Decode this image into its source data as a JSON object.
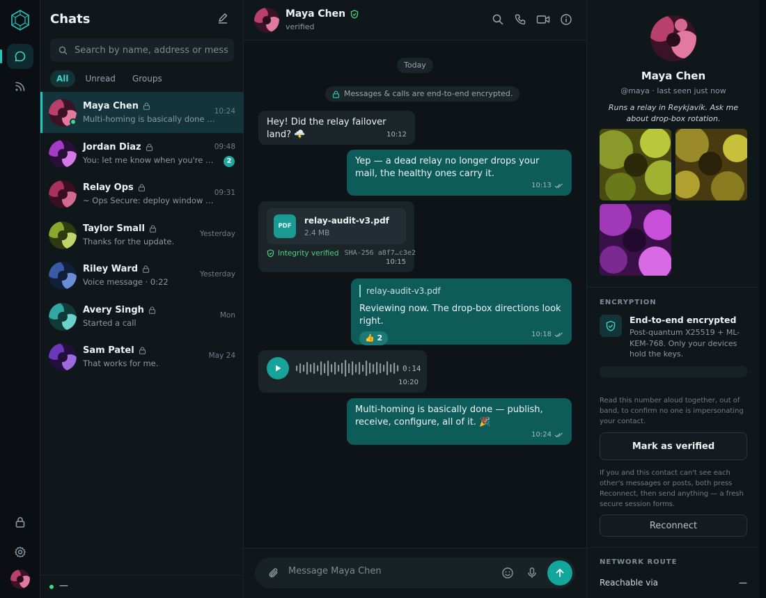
{
  "rail": {
    "items": [
      "chats",
      "feeds"
    ]
  },
  "list": {
    "title": "Chats",
    "search_placeholder": "Search by name, address or message",
    "filters": [
      "All",
      "Unread",
      "Groups"
    ],
    "chats": [
      {
        "name": "Maya Chen",
        "preview": "Multi-homing is basically done 🎉",
        "time": "10:24",
        "online": true,
        "colors": [
          "#3a1426",
          "#b8406a",
          "#e27aa0"
        ]
      },
      {
        "name": "Jordan Diaz",
        "preview": "You: let me know when you're free",
        "time": "09:48",
        "badge": "2",
        "colors": [
          "#2a0f3a",
          "#a53cc8",
          "#d37ae6"
        ]
      },
      {
        "name": "Relay Ops",
        "preview": "~ Ops Secure: deploy window co...",
        "time": "09:31",
        "colors": [
          "#3a1020",
          "#a8325a",
          "#d46a8e"
        ]
      },
      {
        "name": "Taylor Small",
        "preview": "Thanks for the update.",
        "time": "Yesterday",
        "colors": [
          "#2e3a10",
          "#8aa82e",
          "#c0d46a"
        ]
      },
      {
        "name": "Riley Ward",
        "preview": "Voice message · 0:22",
        "time": "Yesterday",
        "colors": [
          "#10203a",
          "#3a5aa8",
          "#6a8ed4"
        ]
      },
      {
        "name": "Avery Singh",
        "preview": "Started a call",
        "time": "Mon",
        "colors": [
          "#0f3a38",
          "#2ea8a0",
          "#6ad4cc"
        ]
      },
      {
        "name": "Sam Patel",
        "preview": "That works for me.",
        "time": "May 24",
        "colors": [
          "#22103a",
          "#6a38b8",
          "#9e6ae0"
        ]
      }
    ],
    "status_text": "—"
  },
  "conversation": {
    "name": "Maya Chen",
    "subtitle": "verified",
    "date_pill": "Today",
    "e2e_notice": "Messages & calls are end-to-end encrypted.",
    "messages": {
      "m1": {
        "text": "Hey! Did the relay failover land? 🌩️",
        "time": "10:12"
      },
      "m2": {
        "text": "Yep — a dead relay no longer drops your mail, the healthy ones carry it.",
        "time": "10:13"
      },
      "m3": {
        "file_name": "relay-audit-v3.pdf",
        "file_size": "2.4 MB",
        "file_type": "PDF",
        "integrity": "Integrity verified",
        "hash": "SHA-256 a8f7…c3e2",
        "time": "10:15"
      },
      "m4": {
        "reply_to": "relay-audit-v3.pdf",
        "text": "Reviewing now. The drop-box directions look right.",
        "reaction": "👍 2",
        "time": "10:18"
      },
      "m5": {
        "duration": "0:14",
        "time": "10:20"
      },
      "m6": {
        "text": "Multi-homing is basically done — publish, receive, configure, all of it. 🎉",
        "time": "10:24"
      }
    },
    "composer_placeholder": "Message Maya Chen"
  },
  "details": {
    "name": "Maya Chen",
    "subtitle": "@maya · last seen just now",
    "bio": "Runs a relay in Reykjavík. Ask me about drop-box rotation.",
    "encryption_section": "ENCRYPTION",
    "encryption_title": "End-to-end encrypted",
    "encryption_desc": "Post-quantum X25519 + ML-KEM-768. Only your devices hold the keys.",
    "safety_note": "Read this number aloud together, out of band, to confirm no one is impersonating your contact.",
    "verify_button": "Mark as verified",
    "reconnect_note": "If you and this contact can't see each other's messages or posts, both press Reconnect, then send anything — a fresh secure session forms.",
    "reconnect_button": "Reconnect",
    "network_section": "NETWORK ROUTE",
    "reachable_label": "Reachable via",
    "reachable_value": "—"
  },
  "colors": {
    "accent": "#22c7bd",
    "outgoing": "#0d5c5a",
    "incoming": "#1b2429",
    "online": "#3ddc84"
  }
}
